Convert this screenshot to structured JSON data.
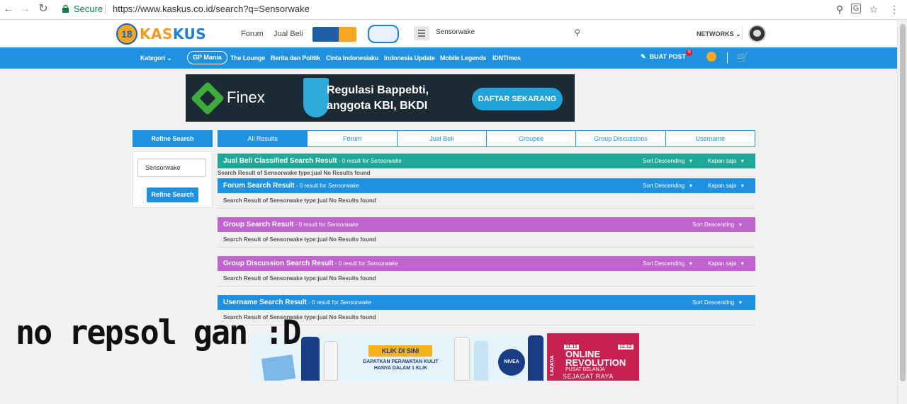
{
  "browser": {
    "secure_label": "Secure",
    "url": "https://www.kaskus.co.id/search?q=Sensorwake"
  },
  "header": {
    "logo_badge": "18",
    "logo_text_kas": "KAS",
    "logo_text_kus": "KUS",
    "nav_forum": "Forum",
    "nav_jualbeli": "Jual Beli",
    "search_query": "Sensorwake",
    "networks_label": "NETWORKS"
  },
  "categorybar": {
    "kategori": "Kategori",
    "links": [
      "GP Mania",
      "The Lounge",
      "Berita dan Politik",
      "Cinta Indonesiaku",
      "Indonesia Update",
      "Mobile Legends",
      "IDNTimes"
    ],
    "buat_post": "BUAT POST",
    "notif_badge": "N"
  },
  "ad_top": {
    "brand": "Finex",
    "message_line1": "Regulasi Bappebti,",
    "message_line2": "anggota KBI, BKDI",
    "cta": "DAFTAR SEKARANG"
  },
  "refine": {
    "heading": "Refine Search",
    "input_value": "Sensorwake",
    "button": "Refine Search"
  },
  "tabs": [
    "All Results",
    "Forum",
    "Jual Beli",
    "Groupee",
    "Group Discussions",
    "Username"
  ],
  "results": {
    "query": "Sensorwake",
    "count_text": " - 0 result for ",
    "sort_label": "Sort Descending",
    "time_label": "Kapan saja",
    "jualbeli_title": "Jual Beli Classified Search Result",
    "jualbeli_body": "Search Result of Sensorwake type:jual No Results found",
    "forum_title": "Forum Search Result",
    "forum_body": "Search Result of Sensorwake type:jual No Results found",
    "group_title": "Group Search Result",
    "group_body": "Search Result of Sensorwake type:jual No Results found",
    "discussion_title": "Group Discussion Search Result",
    "discussion_body": "Search Result of Sensorwake type:jual No Results found",
    "username_title": "Username Search Result",
    "username_body": "Search Result of Sensorwake type:jual No Results found"
  },
  "caption": "no repsol gan :D",
  "ad_bottom": {
    "klik": "KLIK DI SINI",
    "copy_line1": "DAPATKAN PERAWATAN KULIT",
    "copy_line2": "HANYA DALAM 1 KLIK",
    "tin_brand": "NIVEA",
    "lazada": "LAZADA",
    "date1": "11.11",
    "date2": "12.12",
    "headline1": "ONLINE",
    "headline2": "REVOLUTION",
    "sub1": "PUSAT BELANJA",
    "sub2": "SEJAGAT RAYA"
  },
  "colors": {
    "kaskus_blue": "#1e91e0",
    "jualbeli_teal": "#1fa898",
    "group_purple": "#c063ce",
    "logo_orange": "#f49a24"
  }
}
